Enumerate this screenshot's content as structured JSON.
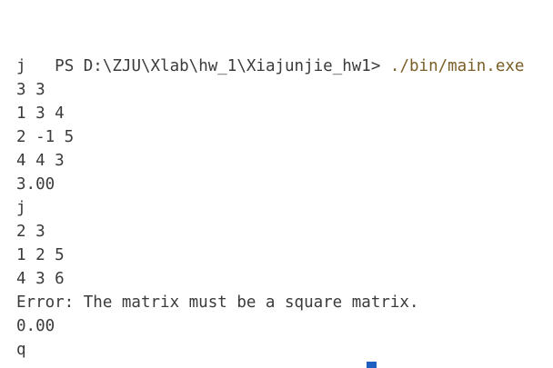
{
  "terminal": {
    "prompt_text": "PS D:\\ZJU\\Xlab\\hw_1\\Xiajunjie_hw1> ",
    "command": "./bin/main.exe",
    "lines": [
      "j",
      "3 3",
      "1 3 4",
      "2 -1 5",
      "4 4 3",
      "3.00",
      "j",
      "2 3",
      "1 2 5",
      "4 3 6",
      "Error: The matrix must be a square matrix.",
      "0.00",
      "q"
    ],
    "colors": {
      "background": "#ffffff",
      "text": "#3b3b3b",
      "command": "#795e26",
      "cursor": "#1f5fbf"
    }
  }
}
